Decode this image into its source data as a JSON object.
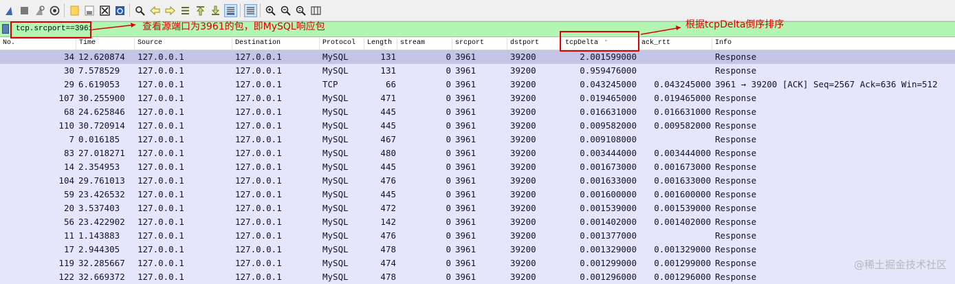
{
  "toolbar": {
    "icons": [
      "shark-fin-icon",
      "stop-capture-icon",
      "restart-capture-icon",
      "capture-options-icon",
      "open-file-icon",
      "save-file-icon",
      "close-file-icon",
      "reload-file-icon",
      "find-packet-icon",
      "go-back-icon",
      "go-forward-icon",
      "go-to-packet-icon",
      "go-first-icon",
      "go-last-icon",
      "autoscroll-icon",
      "colorize-icon",
      "zoom-in-icon",
      "zoom-out-icon",
      "zoom-normal-icon",
      "resize-columns-icon"
    ]
  },
  "filter": {
    "value": "tcp.srcport==3961"
  },
  "annotations": {
    "filter_note": "查看源端口为3961的包，即MySQL响应包",
    "sort_note": "根据tcpDelta倒序排序"
  },
  "columns": [
    "No.",
    "Time",
    "Source",
    "Destination",
    "Protocol",
    "Length",
    "stream",
    "srcport",
    "dstport",
    "tcpDelta",
    "ack_rtt",
    "Info"
  ],
  "rows": [
    {
      "no": "34",
      "time": "12.620874",
      "src": "127.0.0.1",
      "dst": "127.0.0.1",
      "proto": "MySQL",
      "len": "131",
      "stream": "0",
      "srcport": "3961",
      "dstport": "39200",
      "delta": "2.001599000",
      "ackrtt": "",
      "info": "Response",
      "selected": true
    },
    {
      "no": "30",
      "time": "7.578529",
      "src": "127.0.0.1",
      "dst": "127.0.0.1",
      "proto": "MySQL",
      "len": "131",
      "stream": "0",
      "srcport": "3961",
      "dstport": "39200",
      "delta": "0.959476000",
      "ackrtt": "",
      "info": "Response"
    },
    {
      "no": "29",
      "time": "6.619053",
      "src": "127.0.0.1",
      "dst": "127.0.0.1",
      "proto": "TCP",
      "len": "66",
      "stream": "0",
      "srcport": "3961",
      "dstport": "39200",
      "delta": "0.043245000",
      "ackrtt": "0.043245000",
      "info": "3961 → 39200 [ACK] Seq=2567 Ack=636 Win=512"
    },
    {
      "no": "107",
      "time": "30.255900",
      "src": "127.0.0.1",
      "dst": "127.0.0.1",
      "proto": "MySQL",
      "len": "471",
      "stream": "0",
      "srcport": "3961",
      "dstport": "39200",
      "delta": "0.019465000",
      "ackrtt": "0.019465000",
      "info": "Response"
    },
    {
      "no": "68",
      "time": "24.625846",
      "src": "127.0.0.1",
      "dst": "127.0.0.1",
      "proto": "MySQL",
      "len": "445",
      "stream": "0",
      "srcport": "3961",
      "dstport": "39200",
      "delta": "0.016631000",
      "ackrtt": "0.016631000",
      "info": "Response"
    },
    {
      "no": "110",
      "time": "30.720914",
      "src": "127.0.0.1",
      "dst": "127.0.0.1",
      "proto": "MySQL",
      "len": "445",
      "stream": "0",
      "srcport": "3961",
      "dstport": "39200",
      "delta": "0.009582000",
      "ackrtt": "0.009582000",
      "info": "Response"
    },
    {
      "no": "7",
      "time": "0.016185",
      "src": "127.0.0.1",
      "dst": "127.0.0.1",
      "proto": "MySQL",
      "len": "467",
      "stream": "0",
      "srcport": "3961",
      "dstport": "39200",
      "delta": "0.009108000",
      "ackrtt": "",
      "info": "Response"
    },
    {
      "no": "83",
      "time": "27.018271",
      "src": "127.0.0.1",
      "dst": "127.0.0.1",
      "proto": "MySQL",
      "len": "480",
      "stream": "0",
      "srcport": "3961",
      "dstport": "39200",
      "delta": "0.003444000",
      "ackrtt": "0.003444000",
      "info": "Response"
    },
    {
      "no": "14",
      "time": "2.354953",
      "src": "127.0.0.1",
      "dst": "127.0.0.1",
      "proto": "MySQL",
      "len": "445",
      "stream": "0",
      "srcport": "3961",
      "dstport": "39200",
      "delta": "0.001673000",
      "ackrtt": "0.001673000",
      "info": "Response"
    },
    {
      "no": "104",
      "time": "29.761013",
      "src": "127.0.0.1",
      "dst": "127.0.0.1",
      "proto": "MySQL",
      "len": "476",
      "stream": "0",
      "srcport": "3961",
      "dstport": "39200",
      "delta": "0.001633000",
      "ackrtt": "0.001633000",
      "info": "Response"
    },
    {
      "no": "59",
      "time": "23.426532",
      "src": "127.0.0.1",
      "dst": "127.0.0.1",
      "proto": "MySQL",
      "len": "445",
      "stream": "0",
      "srcport": "3961",
      "dstport": "39200",
      "delta": "0.001600000",
      "ackrtt": "0.001600000",
      "info": "Response"
    },
    {
      "no": "20",
      "time": "3.537403",
      "src": "127.0.0.1",
      "dst": "127.0.0.1",
      "proto": "MySQL",
      "len": "472",
      "stream": "0",
      "srcport": "3961",
      "dstport": "39200",
      "delta": "0.001539000",
      "ackrtt": "0.001539000",
      "info": "Response"
    },
    {
      "no": "56",
      "time": "23.422902",
      "src": "127.0.0.1",
      "dst": "127.0.0.1",
      "proto": "MySQL",
      "len": "142",
      "stream": "0",
      "srcport": "3961",
      "dstport": "39200",
      "delta": "0.001402000",
      "ackrtt": "0.001402000",
      "info": "Response"
    },
    {
      "no": "11",
      "time": "1.143883",
      "src": "127.0.0.1",
      "dst": "127.0.0.1",
      "proto": "MySQL",
      "len": "476",
      "stream": "0",
      "srcport": "3961",
      "dstport": "39200",
      "delta": "0.001377000",
      "ackrtt": "",
      "info": "Response"
    },
    {
      "no": "17",
      "time": "2.944305",
      "src": "127.0.0.1",
      "dst": "127.0.0.1",
      "proto": "MySQL",
      "len": "478",
      "stream": "0",
      "srcport": "3961",
      "dstport": "39200",
      "delta": "0.001329000",
      "ackrtt": "0.001329000",
      "info": "Response"
    },
    {
      "no": "119",
      "time": "32.285667",
      "src": "127.0.0.1",
      "dst": "127.0.0.1",
      "proto": "MySQL",
      "len": "474",
      "stream": "0",
      "srcport": "3961",
      "dstport": "39200",
      "delta": "0.001299000",
      "ackrtt": "0.001299000",
      "info": "Response"
    },
    {
      "no": "122",
      "time": "32.669372",
      "src": "127.0.0.1",
      "dst": "127.0.0.1",
      "proto": "MySQL",
      "len": "478",
      "stream": "0",
      "srcport": "3961",
      "dstport": "39200",
      "delta": "0.001296000",
      "ackrtt": "0.001296000",
      "info": "Response"
    }
  ],
  "watermark": "@稀土掘金技术社区",
  "colors": {
    "row_bg": "#e6e6fa",
    "row_selected": "#c4c4e4",
    "filter_bg": "#b3f5b3",
    "annotation": "#e00000"
  }
}
